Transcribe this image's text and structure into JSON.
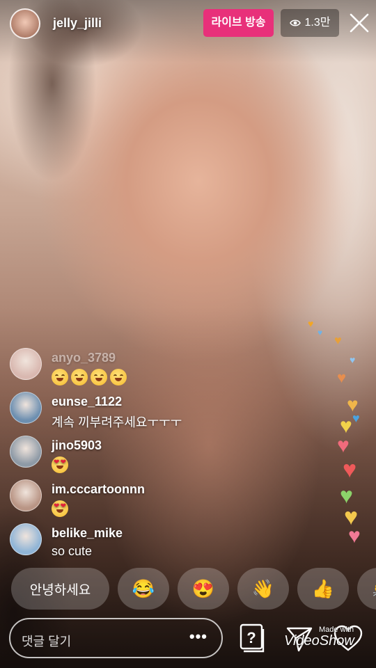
{
  "header": {
    "username": "jelly_jilli",
    "live_label": "라이브 방송",
    "viewer_count": "1.3만"
  },
  "comments": [
    {
      "user": "anyo_3789",
      "text": "",
      "emoji": [
        "smile",
        "smile",
        "smile",
        "smile"
      ],
      "faded": true,
      "avatar_color": "#d9b8b0"
    },
    {
      "user": "eunse_1122",
      "text": "계속 끼부려주세요ㅜㅜㅜ",
      "emoji": [],
      "faded": false,
      "avatar_color": "#6d8fb0"
    },
    {
      "user": "jino5903",
      "text": "",
      "emoji": [
        "heart-eyes"
      ],
      "faded": false,
      "avatar_color": "#8e9aa6"
    },
    {
      "user": "im.cccartoonnn",
      "text": "",
      "emoji": [
        "heart-eyes"
      ],
      "faded": false,
      "avatar_color": "#b99585"
    },
    {
      "user": "belike_mike",
      "text": "so cute",
      "emoji": [],
      "faded": false,
      "avatar_color": "#8fb4d6"
    }
  ],
  "quick_replies": {
    "greeting": "안녕하세요",
    "emoji": [
      "😂",
      "😍",
      "👋",
      "👍",
      "👏"
    ]
  },
  "input": {
    "placeholder": "댓글 달기",
    "more": "•••"
  },
  "watermark": {
    "made_with": "Made with",
    "brand": "VideoShow"
  },
  "colors": {
    "live_badge": "#e8307a"
  }
}
